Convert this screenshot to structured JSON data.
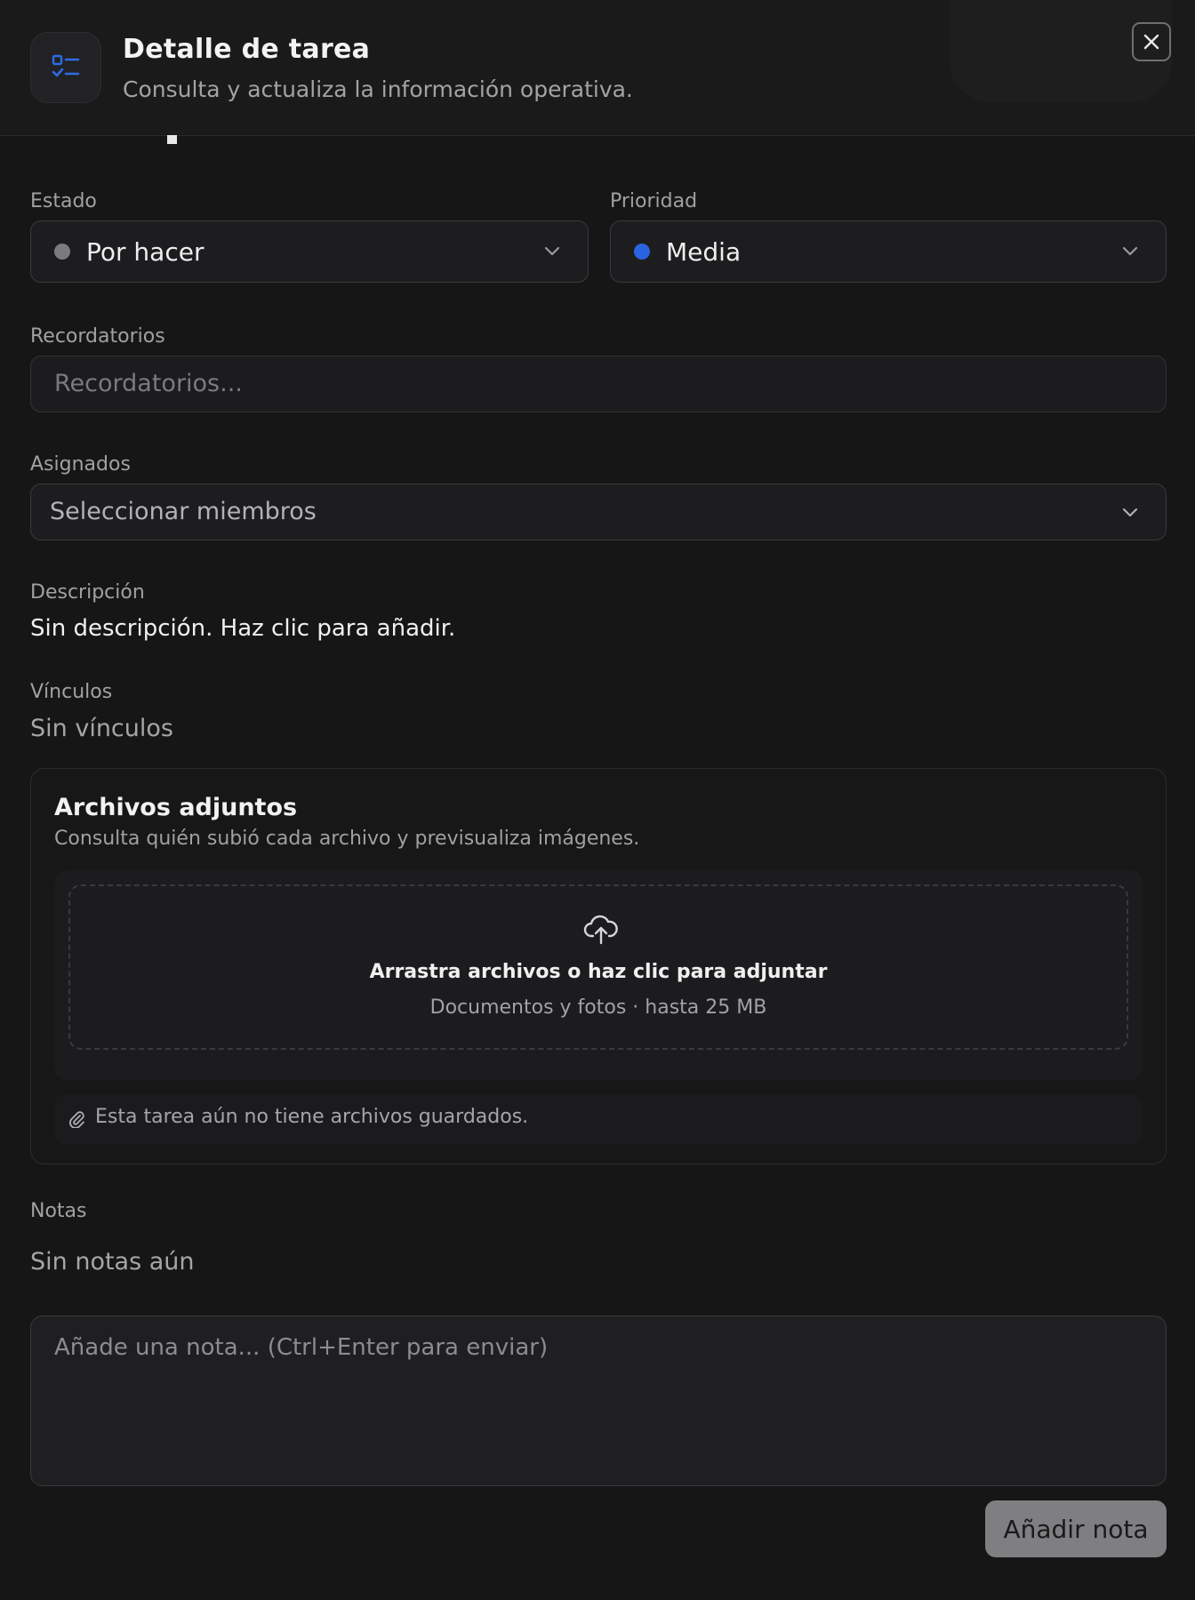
{
  "header": {
    "title": "Detalle de tarea",
    "subtitle": "Consulta y actualiza la información operativa.",
    "icon": "task-list-icon",
    "close_icon": "close-icon"
  },
  "status": {
    "label": "Estado",
    "value": "Por hacer",
    "dot_color": "#7b7b7f"
  },
  "priority": {
    "label": "Prioridad",
    "value": "Media",
    "dot_color": "#2a63e0"
  },
  "reminders": {
    "label": "Recordatorios",
    "placeholder": "Recordatorios..."
  },
  "assignees": {
    "label": "Asignados",
    "placeholder": "Seleccionar miembros"
  },
  "description": {
    "label": "Descripción",
    "value": "Sin descripción. Haz clic para añadir."
  },
  "links": {
    "label": "Vínculos",
    "value": "Sin vínculos"
  },
  "attachments": {
    "title": "Archivos adjuntos",
    "subtitle": "Consulta quién subió cada archivo y previsualiza imágenes.",
    "dropzone_title": "Arrastra archivos o haz clic para adjuntar",
    "dropzone_hint": "Documentos y fotos · hasta 25 MB",
    "empty_text": "Esta tarea aún no tiene archivos guardados.",
    "upload_icon": "cloud-upload-icon",
    "paperclip_icon": "paperclip-icon"
  },
  "notes": {
    "label": "Notas",
    "empty_text": "Sin notas aún",
    "placeholder": "Añade una nota... (Ctrl+Enter para enviar)",
    "submit_label": "Añadir nota"
  },
  "colors": {
    "background": "#161617",
    "accent": "#2a63e0"
  }
}
